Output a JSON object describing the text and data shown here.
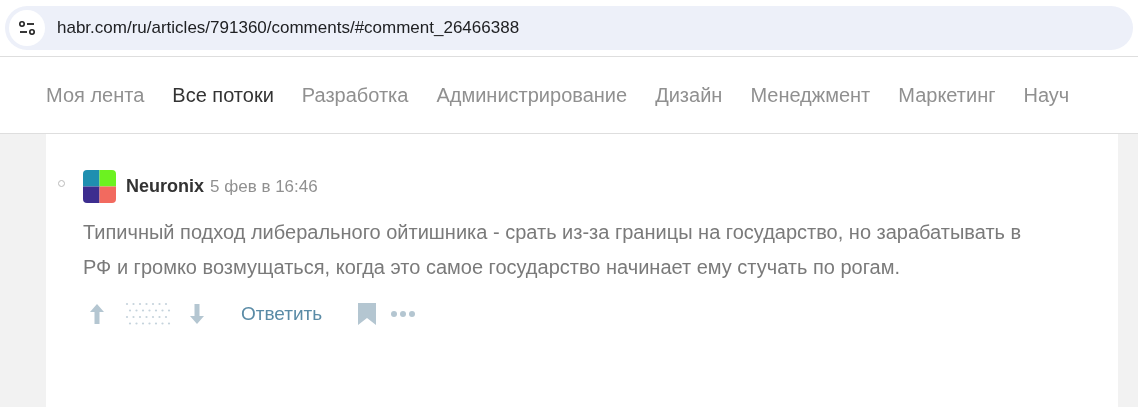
{
  "address_bar": {
    "url": "habr.com/ru/articles/791360/comments/#comment_26466388"
  },
  "nav": {
    "tabs": [
      {
        "label": "Моя лента",
        "selected": false
      },
      {
        "label": "Все потоки",
        "selected": true
      },
      {
        "label": "Разработка",
        "selected": false
      },
      {
        "label": "Администрирование",
        "selected": false
      },
      {
        "label": "Дизайн",
        "selected": false
      },
      {
        "label": "Менеджмент",
        "selected": false
      },
      {
        "label": "Маркетинг",
        "selected": false
      },
      {
        "label": "Науч",
        "selected": false
      }
    ]
  },
  "comment": {
    "author": "Neuronix",
    "time": "5 фев в 16:46",
    "text": "Типичный подход либерального ойтишника - срать из-за границы на государство, но зарабатывать в РФ и громко возмущаться, когда это самое государство начинает ему стучать по рогам.",
    "reply": "Ответить"
  }
}
